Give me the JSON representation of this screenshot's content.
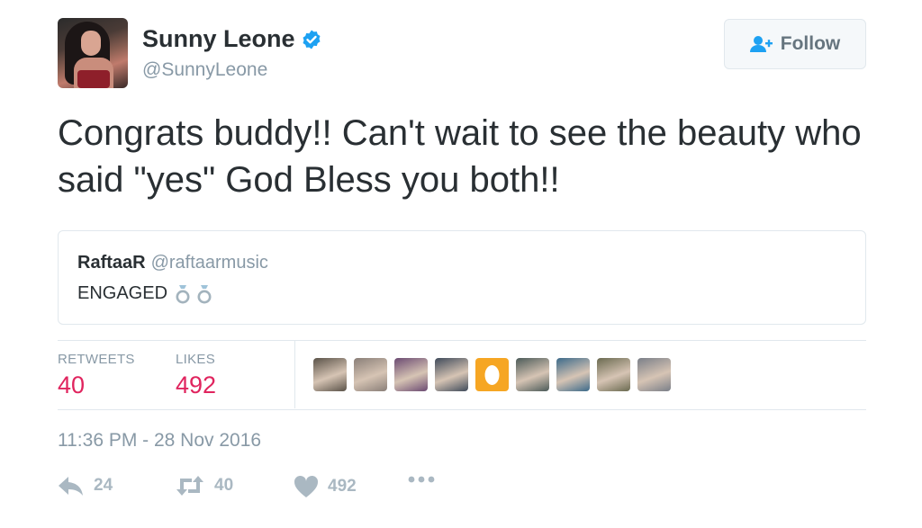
{
  "author": {
    "name": "Sunny Leone",
    "handle": "@SunnyLeone",
    "verified_icon": "verified-badge-icon",
    "avatar_icon": "profile-photo"
  },
  "follow_button": {
    "label": "Follow",
    "icon": "add-user-icon"
  },
  "tweet": {
    "text": "Congrats buddy!! Can't wait to see the beauty who said \"yes\" God Bless you both!!"
  },
  "quoted_tweet": {
    "name": "RaftaaR",
    "handle": "@raftaarmusic",
    "text": "ENGAGED",
    "emoji_icons": [
      "ring-icon",
      "ring-icon"
    ]
  },
  "stats": {
    "retweets_label": "RETWEETS",
    "retweets_value": "40",
    "likes_label": "LIKES",
    "likes_value": "492"
  },
  "likers": [
    {
      "color": "#5a5248"
    },
    {
      "color": "#8a7f78"
    },
    {
      "color": "#6b4a72"
    },
    {
      "color": "#3f4a5a"
    },
    {
      "color": "#f6a623"
    },
    {
      "color": "#4b5a58"
    },
    {
      "color": "#3c6a8a"
    },
    {
      "color": "#6a6a50"
    },
    {
      "color": "#7a7f88"
    }
  ],
  "timestamp": "11:36 PM - 28 Nov 2016",
  "actions": {
    "reply_count": "24",
    "retweet_count": "40",
    "like_count": "492"
  },
  "colors": {
    "accent_like": "#e0245e",
    "verified": "#1da1f2",
    "muted": "#8899a6"
  }
}
